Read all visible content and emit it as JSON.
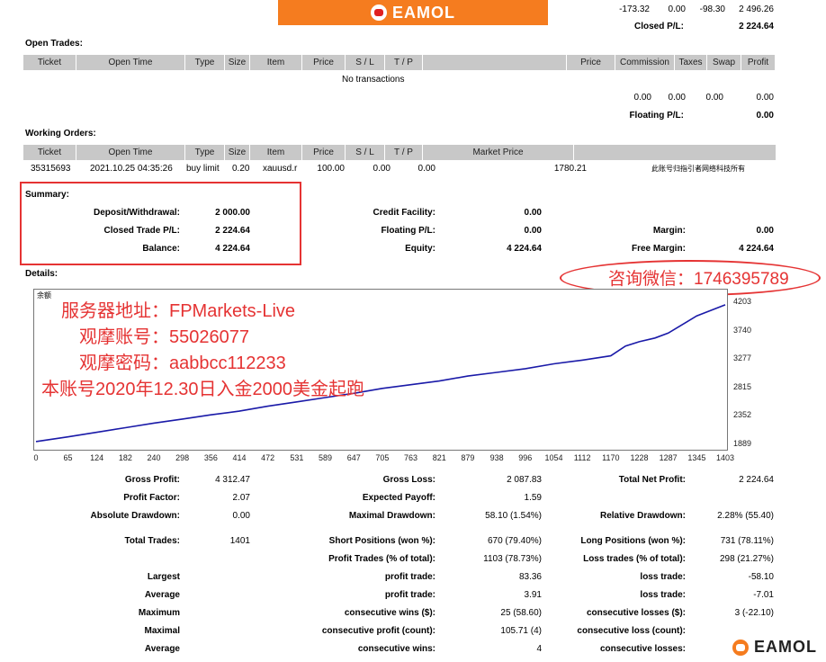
{
  "banner": {
    "logo_text": "EAMOL",
    "logo_icon": "eamol-logo-icon"
  },
  "top_summary": {
    "values": [
      "-173.32",
      "0.00",
      "-98.30",
      "2 496.26"
    ],
    "closed_pl_label": "Closed P/L:",
    "closed_pl_value": "2 224.64"
  },
  "open_trades": {
    "title": "Open Trades:",
    "columns": [
      "Ticket",
      "Open Time",
      "Type",
      "Size",
      "Item",
      "Price",
      "S / L",
      "T / P",
      "",
      "Price",
      "Commission",
      "Taxes",
      "Swap",
      "Profit"
    ],
    "empty_text": "No transactions",
    "totals": [
      "0.00",
      "0.00",
      "0.00",
      "0.00"
    ],
    "floating_label": "Floating P/L:",
    "floating_value": "0.00"
  },
  "working_orders": {
    "title": "Working Orders:",
    "columns": [
      "Ticket",
      "Open Time",
      "Type",
      "Size",
      "Item",
      "Price",
      "S / L",
      "T / P",
      "Market Price",
      ""
    ],
    "row": {
      "ticket": "35315693",
      "open_time": "2021.10.25 04:35:26",
      "type": "buy limit",
      "size": "0.20",
      "item": "xauusd.r",
      "price": "100.00",
      "sl": "0.00",
      "tp": "0.00",
      "market_price": "1780.21",
      "note": "此账号归指引者网络科技所有"
    }
  },
  "summary": {
    "title": "Summary:",
    "deposit_label": "Deposit/Withdrawal:",
    "deposit_value": "2 000.00",
    "closed_label": "Closed Trade P/L:",
    "closed_value": "2 224.64",
    "balance_label": "Balance:",
    "balance_value": "4 224.64",
    "credit_label": "Credit Facility:",
    "credit_value": "0.00",
    "floating_label": "Floating P/L:",
    "floating_value": "0.00",
    "equity_label": "Equity:",
    "equity_value": "4 224.64",
    "margin_label": "Margin:",
    "margin_value": "0.00",
    "free_margin_label": "Free Margin:",
    "free_margin_value": "4 224.64"
  },
  "details": {
    "title": "Details:"
  },
  "overlay": {
    "contact": "咨询微信：1746395789",
    "server": "服务器地址：FPMarkets-Live",
    "account": "观摩账号：55026077",
    "password": "观摩密码：aabbcc112233",
    "note": "本账号2020年12.30日入金2000美金起跑"
  },
  "chart_data": {
    "type": "line",
    "title": "余额",
    "xlabel": "",
    "ylabel": "",
    "x_ticks": [
      "0",
      "65",
      "124",
      "182",
      "240",
      "298",
      "356",
      "414",
      "472",
      "531",
      "589",
      "647",
      "705",
      "763",
      "821",
      "879",
      "938",
      "996",
      "1054",
      "1112",
      "1170",
      "1228",
      "1287",
      "1345",
      "1403"
    ],
    "y_ticks": [
      "4203",
      "3740",
      "3277",
      "2815",
      "2352",
      "1889"
    ],
    "xlim": [
      0,
      1403
    ],
    "ylim": [
      1889,
      4203
    ],
    "grid": false,
    "series": [
      {
        "color": "#1a1aa8",
        "x": [
          0,
          65,
          124,
          182,
          240,
          298,
          356,
          414,
          472,
          531,
          589,
          647,
          705,
          763,
          821,
          879,
          938,
          996,
          1054,
          1112,
          1170,
          1200,
          1228,
          1260,
          1287,
          1345,
          1403
        ],
        "y": [
          1935,
          2010,
          2085,
          2160,
          2235,
          2300,
          2370,
          2430,
          2510,
          2580,
          2650,
          2720,
          2800,
          2860,
          2920,
          3000,
          3060,
          3120,
          3200,
          3260,
          3330,
          3490,
          3560,
          3620,
          3700,
          3980,
          4160
        ]
      }
    ]
  },
  "stats": {
    "gross_profit_label": "Gross Profit:",
    "gross_profit": "4 312.47",
    "gross_loss_label": "Gross Loss:",
    "gross_loss": "2 087.83",
    "net_profit_label": "Total Net Profit:",
    "net_profit": "2 224.64",
    "profit_factor_label": "Profit Factor:",
    "profit_factor": "2.07",
    "expected_payoff_label": "Expected Payoff:",
    "expected_payoff": "1.59",
    "abs_dd_label": "Absolute Drawdown:",
    "abs_dd": "0.00",
    "max_dd_label": "Maximal Drawdown:",
    "max_dd": "58.10 (1.54%)",
    "rel_dd_label": "Relative Drawdown:",
    "rel_dd": "2.28% (55.40)",
    "total_trades_label": "Total Trades:",
    "total_trades": "1401",
    "short_label": "Short Positions (won %):",
    "short": "670 (79.40%)",
    "long_label": "Long Positions (won %):",
    "long": "731 (78.11%)",
    "profit_trades_label": "Profit Trades (% of total):",
    "profit_trades": "1103 (78.73%)",
    "loss_trades_label": "Loss trades (% of total):",
    "loss_trades": "298 (21.27%)",
    "largest_label": "Largest",
    "largest_profit_label": "profit trade:",
    "largest_profit": "83.36",
    "largest_loss_label": "loss trade:",
    "largest_loss": "-58.10",
    "average_label": "Average",
    "average_profit_label": "profit trade:",
    "average_profit": "3.91",
    "average_loss_label": "loss trade:",
    "average_loss": "-7.01",
    "maximum_label": "Maximum",
    "max_cw_label": "consecutive wins ($):",
    "max_cw": "25 (58.60)",
    "max_cl_label": "consecutive losses ($):",
    "max_cl": "3 (-22.10)",
    "maximal_label": "Maximal",
    "maximal_cp_label": "consecutive profit (count):",
    "maximal_cp": "105.71 (4)",
    "maximal_cl_label": "consecutive loss (count):",
    "maximal_cl": "",
    "average2_label": "Average",
    "avg_cw_label": "consecutive wins:",
    "avg_cw": "4",
    "avg_cl_label": "consecutive losses:",
    "avg_cl": ""
  },
  "watermark": {
    "text": "EAMOL"
  }
}
